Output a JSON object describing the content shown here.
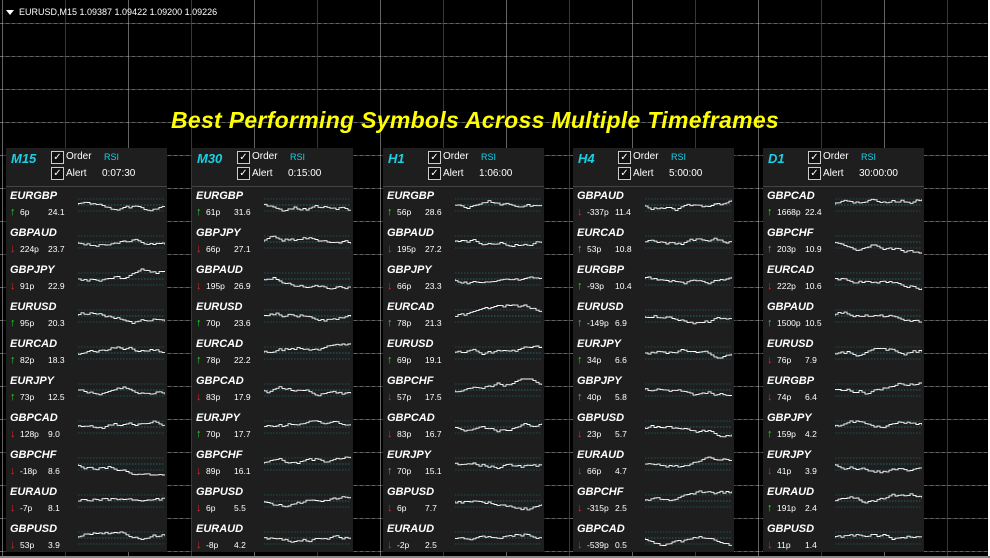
{
  "header": {
    "symbol_line": "EURUSD,M15  1.09387 1.09422 1.09200 1.09226",
    "title": "Best Performing Symbols Across Multiple Timeframes"
  },
  "colors": {
    "up": "#22dd22",
    "down": "#ee2222",
    "accent": "#19d1e6",
    "title": "#ffff00"
  },
  "labels": {
    "order": "Order",
    "alert": "Alert",
    "rsi": "RSI",
    "check": "✓"
  },
  "panels": [
    {
      "tf": "M15",
      "timer": "0:07:30",
      "rows": [
        {
          "sym": "EURGBP",
          "dir": "up",
          "pips": "6p",
          "val": "24.1"
        },
        {
          "sym": "GBPAUD",
          "dir": "down",
          "pips": "224p",
          "val": "23.7"
        },
        {
          "sym": "GBPJPY",
          "dir": "down",
          "pips": "91p",
          "val": "22.9"
        },
        {
          "sym": "EURUSD",
          "dir": "up",
          "pips": "95p",
          "val": "20.3"
        },
        {
          "sym": "EURCAD",
          "dir": "up",
          "pips": "82p",
          "val": "18.3"
        },
        {
          "sym": "EURJPY",
          "dir": "up",
          "pips": "73p",
          "val": "12.5"
        },
        {
          "sym": "GBPCAD",
          "dir": "down",
          "pips": "128p",
          "val": "9.0"
        },
        {
          "sym": "GBPCHF",
          "dir": "down",
          "pips": "-18p",
          "val": "8.6"
        },
        {
          "sym": "EURAUD",
          "dir": "down",
          "pips": "-7p",
          "val": "8.1"
        },
        {
          "sym": "GBPUSD",
          "dir": "down",
          "pips": "53p",
          "val": "3.9"
        }
      ]
    },
    {
      "tf": "M30",
      "timer": "0:15:00",
      "rows": [
        {
          "sym": "EURGBP",
          "dir": "up",
          "pips": "61p",
          "val": "31.6"
        },
        {
          "sym": "GBPJPY",
          "dir": "down",
          "pips": "66p",
          "val": "27.1"
        },
        {
          "sym": "GBPAUD",
          "dir": "down",
          "pips": "195p",
          "val": "26.9"
        },
        {
          "sym": "EURUSD",
          "dir": "up",
          "pips": "70p",
          "val": "23.6"
        },
        {
          "sym": "EURCAD",
          "dir": "up",
          "pips": "78p",
          "val": "22.2"
        },
        {
          "sym": "GBPCAD",
          "dir": "down",
          "pips": "83p",
          "val": "17.9"
        },
        {
          "sym": "EURJPY",
          "dir": "up",
          "pips": "70p",
          "val": "17.7"
        },
        {
          "sym": "GBPCHF",
          "dir": "down",
          "pips": "89p",
          "val": "16.1"
        },
        {
          "sym": "GBPUSD",
          "dir": "down",
          "pips": "6p",
          "val": "5.5"
        },
        {
          "sym": "EURAUD",
          "dir": "down",
          "pips": "-8p",
          "val": "4.2"
        }
      ]
    },
    {
      "tf": "H1",
      "timer": "1:06:00",
      "rows": [
        {
          "sym": "EURGBP",
          "dir": "up",
          "pips": "56p",
          "val": "28.6"
        },
        {
          "sym": "GBPAUD",
          "dir": "down",
          "pips": "195p",
          "val": "27.2"
        },
        {
          "sym": "GBPJPY",
          "dir": "down",
          "pips": "66p",
          "val": "23.3"
        },
        {
          "sym": "EURCAD",
          "dir": "up",
          "pips": "78p",
          "val": "21.3"
        },
        {
          "sym": "EURUSD",
          "dir": "up",
          "pips": "69p",
          "val": "19.1"
        },
        {
          "sym": "GBPCHF",
          "dir": "down",
          "pips": "57p",
          "val": "17.5"
        },
        {
          "sym": "GBPCAD",
          "dir": "down",
          "pips": "83p",
          "val": "16.7"
        },
        {
          "sym": "EURJPY",
          "dir": "up",
          "pips": "70p",
          "val": "15.1"
        },
        {
          "sym": "GBPUSD",
          "dir": "down",
          "pips": "6p",
          "val": "7.7"
        },
        {
          "sym": "EURAUD",
          "dir": "down",
          "pips": "-2p",
          "val": "2.5"
        }
      ]
    },
    {
      "tf": "H4",
      "timer": "5:00:00",
      "rows": [
        {
          "sym": "GBPAUD",
          "dir": "down",
          "pips": "-337p",
          "val": "11.4"
        },
        {
          "sym": "EURCAD",
          "dir": "up",
          "pips": "53p",
          "val": "10.8"
        },
        {
          "sym": "EURGBP",
          "dir": "up",
          "pips": "-93p",
          "val": "10.4"
        },
        {
          "sym": "EURUSD",
          "dir": "up",
          "pips": "-149p",
          "val": "6.9"
        },
        {
          "sym": "EURJPY",
          "dir": "up",
          "pips": "34p",
          "val": "6.6"
        },
        {
          "sym": "GBPJPY",
          "dir": "up",
          "pips": "40p",
          "val": "5.8"
        },
        {
          "sym": "GBPUSD",
          "dir": "down",
          "pips": "23p",
          "val": "5.7"
        },
        {
          "sym": "EURAUD",
          "dir": "down",
          "pips": "66p",
          "val": "4.7"
        },
        {
          "sym": "GBPCHF",
          "dir": "down",
          "pips": "-315p",
          "val": "2.5"
        },
        {
          "sym": "GBPCAD",
          "dir": "down",
          "pips": "-539p",
          "val": "0.5"
        }
      ]
    },
    {
      "tf": "D1",
      "timer": "30:00:00",
      "rows": [
        {
          "sym": "GBPCAD",
          "dir": "up",
          "pips": "1668p",
          "val": "22.4"
        },
        {
          "sym": "GBPCHF",
          "dir": "up",
          "pips": "203p",
          "val": "10.9"
        },
        {
          "sym": "EURCAD",
          "dir": "down",
          "pips": "222p",
          "val": "10.6"
        },
        {
          "sym": "GBPAUD",
          "dir": "up",
          "pips": "1500p",
          "val": "10.5"
        },
        {
          "sym": "EURUSD",
          "dir": "down",
          "pips": "76p",
          "val": "7.9"
        },
        {
          "sym": "EURGBP",
          "dir": "down",
          "pips": "74p",
          "val": "6.4"
        },
        {
          "sym": "GBPJPY",
          "dir": "up",
          "pips": "159p",
          "val": "4.2"
        },
        {
          "sym": "EURJPY",
          "dir": "down",
          "pips": "41p",
          "val": "3.9"
        },
        {
          "sym": "EURAUD",
          "dir": "up",
          "pips": "191p",
          "val": "2.4"
        },
        {
          "sym": "GBPUSD",
          "dir": "down",
          "pips": "11p",
          "val": "1.4"
        }
      ]
    }
  ]
}
